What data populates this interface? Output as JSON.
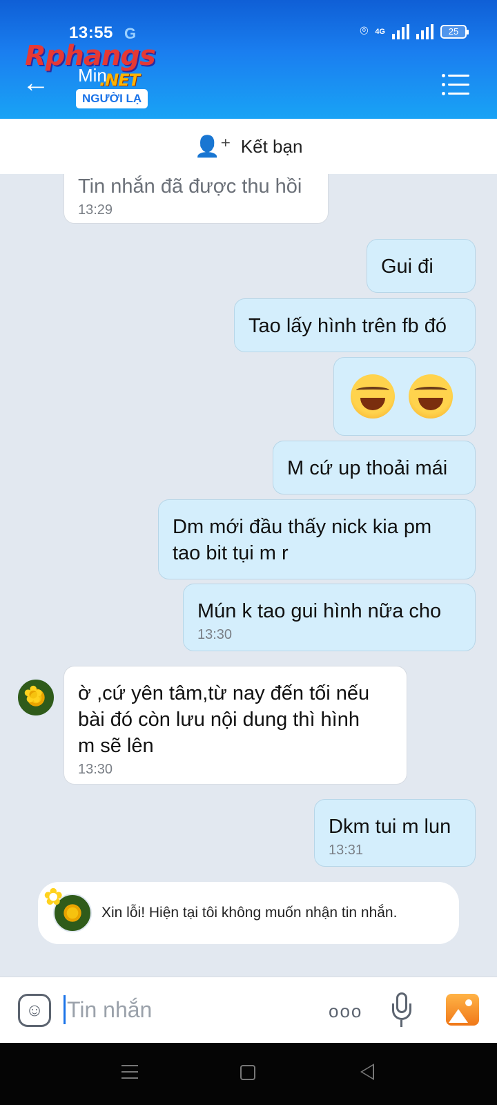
{
  "status_bar": {
    "time": "13:55",
    "g_badge": "G",
    "network": "4G",
    "battery": "25"
  },
  "header": {
    "contact_name": "Min",
    "stranger_badge": "NGƯỜI LẠ",
    "watermark_main": "Rphangs",
    "watermark_sub": ".NET"
  },
  "add_friend": {
    "label": "Kết bạn"
  },
  "messages": [
    {
      "dir": "in",
      "text": "Tin nhắn đã được thu hồi",
      "time": "13:29"
    },
    {
      "dir": "out",
      "text": "Gui đi"
    },
    {
      "dir": "out",
      "text": "Tao lấy hình trên fb đó"
    },
    {
      "dir": "out",
      "emoji": "laughing-crying-emoji x2"
    },
    {
      "dir": "out",
      "text": "M cứ up thoải mái"
    },
    {
      "dir": "out",
      "text1": "Dm mới đầu thấy nick kia pm",
      "text2": "tao bit tụi m r"
    },
    {
      "dir": "out",
      "text": "Mún k tao gui hình nữa cho",
      "time": "13:30"
    },
    {
      "dir": "in",
      "text1": "ờ ,cứ yên tâm,từ nay đến tối nếu",
      "text2": "bài đó còn lưu nội dung thì hình",
      "text3": "m sẽ lên",
      "time": "13:30"
    },
    {
      "dir": "out",
      "text": "Dkm tui m lun",
      "time": "13:31"
    }
  ],
  "notice": {
    "text": "Xin lỗi! Hiện tại tôi không muốn nhận tin nhắn."
  },
  "input_bar": {
    "placeholder": "Tin nhắn",
    "more": "ooo"
  },
  "colors": {
    "header_top": "#0f5fd6",
    "header_bottom": "#19a3f5",
    "outgoing_bubble": "#d4eefc",
    "incoming_bubble": "#ffffff",
    "chat_bg": "#e2e8f0"
  }
}
